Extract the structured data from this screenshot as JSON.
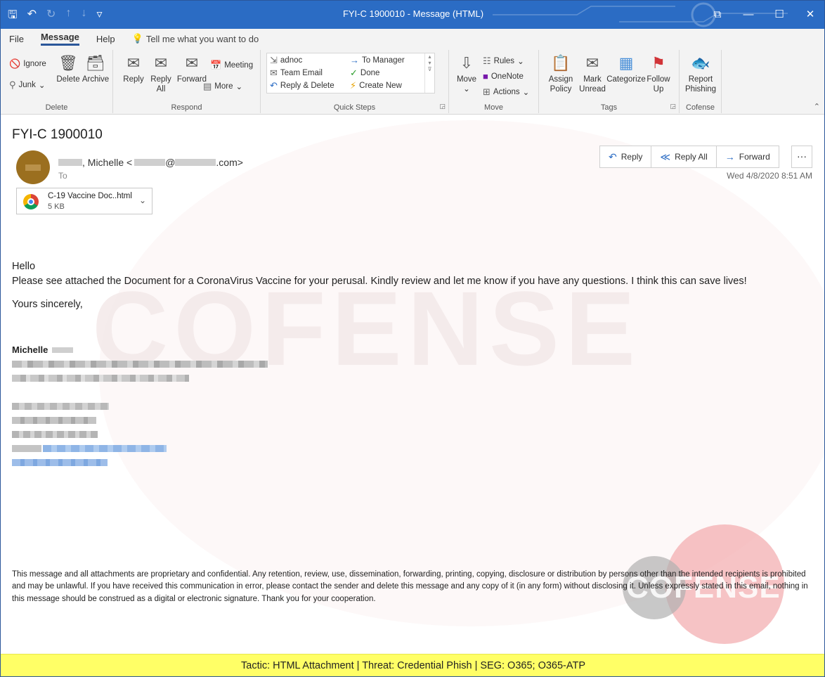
{
  "window": {
    "title": "FYI-C 1900010  -  Message (HTML)"
  },
  "menu": {
    "items": [
      "File",
      "Message",
      "Help"
    ],
    "active": "Message",
    "tell_me": "Tell me what you want to do"
  },
  "ribbon": {
    "delete_group": {
      "label": "Delete",
      "ignore": "Ignore",
      "junk": "Junk",
      "delete": "Delete",
      "archive": "Archive"
    },
    "respond_group": {
      "label": "Respond",
      "reply": "Reply",
      "reply_all": "Reply All",
      "forward": "Forward",
      "meeting": "Meeting",
      "more": "More"
    },
    "quick_steps_group": {
      "label": "Quick Steps",
      "items": [
        "adnoc",
        "To Manager",
        "Team Email",
        "Done",
        "Reply & Delete",
        "Create New"
      ]
    },
    "move_group": {
      "label": "Move",
      "move": "Move",
      "rules": "Rules",
      "onenote": "OneNote",
      "actions": "Actions"
    },
    "tags_group": {
      "label": "Tags",
      "assign_policy": "Assign Policy",
      "mark_unread": "Mark Unread",
      "categorize": "Categorize",
      "follow_up": "Follow Up"
    },
    "cofense_group": {
      "label": "Cofense",
      "report_phishing": "Report Phishing"
    }
  },
  "message": {
    "subject": "FYI-C 1900010",
    "sender_name": ", Michelle <",
    "sender_at": "@",
    "sender_tld": ".com>",
    "to_label": "To",
    "date": "Wed 4/8/2020 8:51 AM",
    "actions": {
      "reply": "Reply",
      "reply_all": "Reply All",
      "forward": "Forward",
      "more": "···"
    },
    "attachment": {
      "name": "C-19 Vaccine Doc..html",
      "size": "5 KB"
    },
    "body": {
      "greeting": "Hello",
      "text": "Please see attached the Document for a CoronaVirus Vaccine for your perusal. Kindly review and let me know if you have any questions. I think this can save lives!",
      "closing": "Yours sincerely,",
      "signature_name": "Michelle"
    },
    "disclaimer": "This message and all attachments are proprietary and confidential. Any retention, review, use, dissemination, forwarding, printing, copying, disclosure or distribution by persons other than the intended recipients is prohibited and may be unlawful. If you have received this communication in error, please contact the sender and delete this message and any copy of it (in any form) without disclosing it. Unless expressly stated in this email, nothing in this message should be construed as a digital or electronic signature. Thank you for your cooperation."
  },
  "watermark": {
    "text": "COFENSE",
    "logo_text": "COFENSE"
  },
  "banner": {
    "text": "Tactic: HTML Attachment | Threat: Credential Phish | SEG: O365; O365-ATP"
  },
  "colors": {
    "title_bar": "#2b6cc4",
    "banner": "#ffff66",
    "accent": "#2b579a"
  }
}
